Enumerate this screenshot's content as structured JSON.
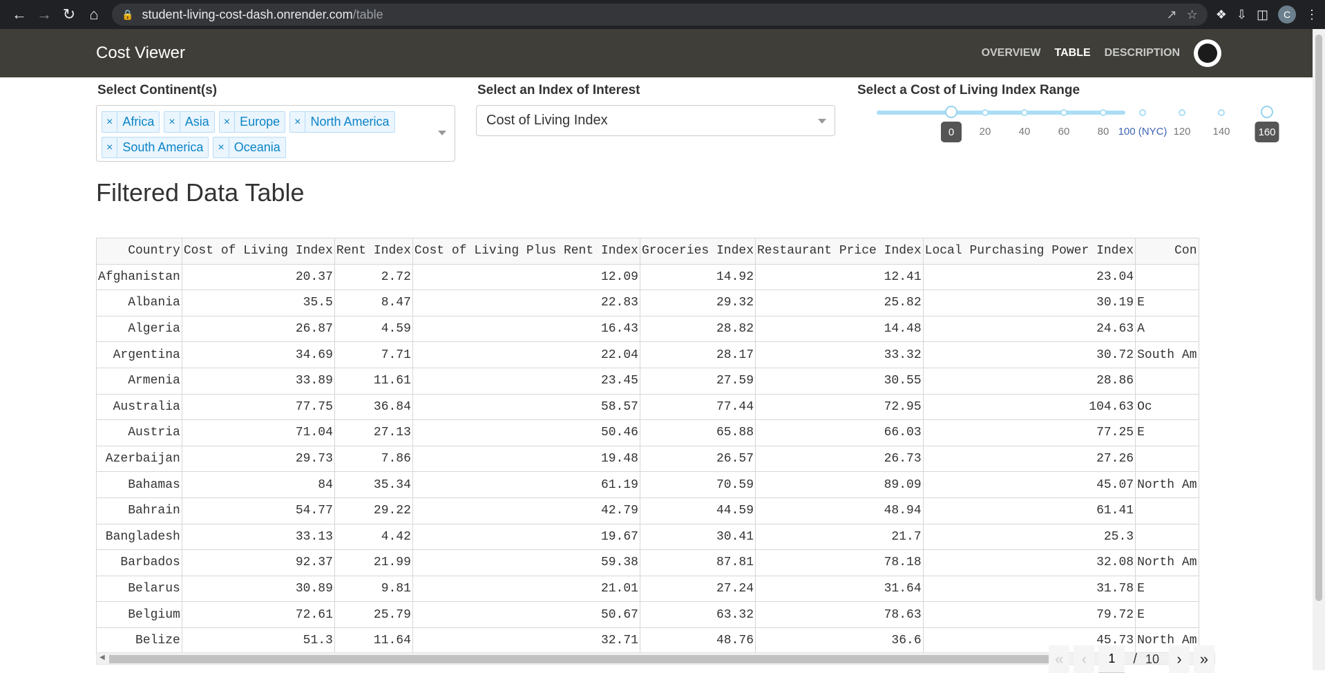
{
  "browser": {
    "host": "student-living-cost-dash.onrender.com",
    "path": "/table",
    "avatar_letter": "C"
  },
  "nav": {
    "brand": "Cost Viewer",
    "links": [
      "OVERVIEW",
      "TABLE",
      "DESCRIPTION"
    ],
    "active": "TABLE"
  },
  "controls": {
    "continent_label": "Select Continent(s)",
    "continents": [
      "Africa",
      "Asia",
      "Europe",
      "North America",
      "South America",
      "Oceania"
    ],
    "index_label": "Select an Index of Interest",
    "index_value": "Cost of Living Index",
    "range_label": "Select a Cost of Living Index Range",
    "range_marks": [
      "20",
      "40",
      "60",
      "80",
      "100 (NYC)",
      "120",
      "140"
    ],
    "range_min": "0",
    "range_max": "160"
  },
  "table": {
    "title": "Filtered Data Table",
    "headers": [
      "Country",
      "Cost of Living Index",
      "Rent Index",
      "Cost of Living Plus Rent Index",
      "Groceries Index",
      "Restaurant Price Index",
      "Local Purchasing Power Index",
      "Con"
    ],
    "rows": [
      [
        "Afghanistan",
        "20.37",
        "2.72",
        "12.09",
        "14.92",
        "12.41",
        "23.04",
        ""
      ],
      [
        "Albania",
        "35.5",
        "8.47",
        "22.83",
        "29.32",
        "25.82",
        "30.19",
        "E"
      ],
      [
        "Algeria",
        "26.87",
        "4.59",
        "16.43",
        "28.82",
        "14.48",
        "24.63",
        "A"
      ],
      [
        "Argentina",
        "34.69",
        "7.71",
        "22.04",
        "28.17",
        "33.32",
        "30.72",
        "South Am"
      ],
      [
        "Armenia",
        "33.89",
        "11.61",
        "23.45",
        "27.59",
        "30.55",
        "28.86",
        ""
      ],
      [
        "Australia",
        "77.75",
        "36.84",
        "58.57",
        "77.44",
        "72.95",
        "104.63",
        "Oc"
      ],
      [
        "Austria",
        "71.04",
        "27.13",
        "50.46",
        "65.88",
        "66.03",
        "77.25",
        "E"
      ],
      [
        "Azerbaijan",
        "29.73",
        "7.86",
        "19.48",
        "26.57",
        "26.73",
        "27.26",
        ""
      ],
      [
        "Bahamas",
        "84",
        "35.34",
        "61.19",
        "70.59",
        "89.09",
        "45.07",
        "North Am"
      ],
      [
        "Bahrain",
        "54.77",
        "29.22",
        "42.79",
        "44.59",
        "48.94",
        "61.41",
        ""
      ],
      [
        "Bangladesh",
        "33.13",
        "4.42",
        "19.67",
        "30.41",
        "21.7",
        "25.3",
        ""
      ],
      [
        "Barbados",
        "92.37",
        "21.99",
        "59.38",
        "87.81",
        "78.18",
        "32.08",
        "North Am"
      ],
      [
        "Belarus",
        "30.89",
        "9.81",
        "21.01",
        "27.24",
        "31.64",
        "31.78",
        "E"
      ],
      [
        "Belgium",
        "72.61",
        "25.79",
        "50.67",
        "63.32",
        "78.63",
        "79.72",
        "E"
      ],
      [
        "Belize",
        "51.3",
        "11.64",
        "32.71",
        "48.76",
        "36.6",
        "45.73",
        "North Am"
      ]
    ]
  },
  "pager": {
    "current": "1",
    "separator": "/",
    "total": "10"
  }
}
